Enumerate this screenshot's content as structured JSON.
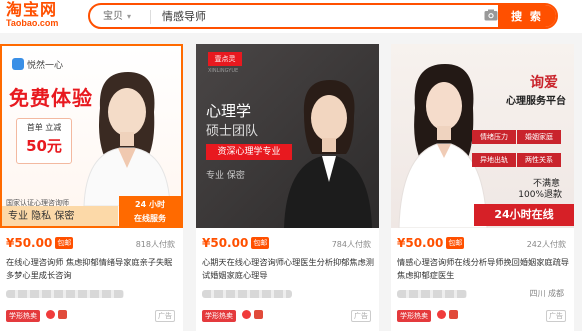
{
  "header": {
    "logo_cn": "淘宝网",
    "logo_en": "Taobao.com",
    "search_scope": "宝贝",
    "search_query": "情感导师",
    "search_button": "搜 索"
  },
  "cards": [
    {
      "brand": "悦然一心",
      "title": "免费体验",
      "box_label": "首单 立减",
      "box_value": "50元",
      "cert": "国家认证心理咨询师",
      "bar_text": "专业  隐私  保密",
      "badge_line1": "24 小时",
      "badge_line2": "在线服务",
      "price": "¥50.00",
      "price_badge": "包邮",
      "paid": "818人付款",
      "desc": "在线心理咨询师 焦虑抑郁情绪导家庭亲子失眠多梦心里成长咨询",
      "location": "",
      "hot": "学形热卖",
      "ad": "广告"
    },
    {
      "logo": "壹点灵",
      "logo_sub": "XINLINGYUE",
      "line1": "心理学",
      "line2": "硕士团队",
      "red_label": "资深心理学专业",
      "line3": "专业  保密",
      "price": "¥50.00",
      "price_badge": "包邮",
      "paid": "784人付款",
      "desc": "心期天在线心理咨询师心理医生分析抑郁焦虑测试婚姻家庭心理导",
      "location": "",
      "hot": "学形热卖",
      "ad": "广告"
    },
    {
      "line1": "询爱",
      "line2": "心理服务平台",
      "tags": [
        "情绪压力",
        "婚姻家庭",
        "异地出轨",
        "两性关系"
      ],
      "sat1": "不满意",
      "sat2": "100%退款",
      "bar_text": "24小时在线",
      "price": "¥50.00",
      "price_badge": "包邮",
      "paid": "242人付款",
      "desc": "情感心理咨询师在线分析导师挽回婚姻家庭疏导焦虑抑郁症医生",
      "location": "四川 成都",
      "hot": "学形热卖",
      "ad": "广告"
    }
  ],
  "colors": {
    "accent": "#ff5000",
    "red": "#e8191f"
  }
}
